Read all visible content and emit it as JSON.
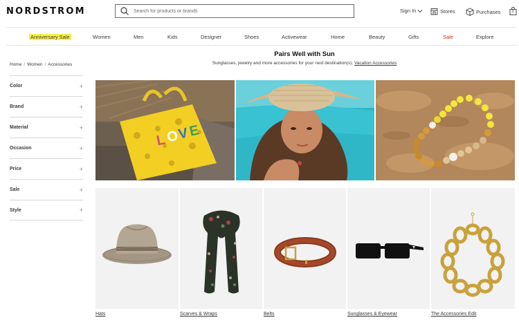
{
  "header": {
    "logo": "NORDSTROM",
    "search_placeholder": "Search for products or brands",
    "sign_in": "Sign In",
    "stores": "Stores",
    "purchases": "Purchases",
    "bag_count": "0"
  },
  "nav": [
    "Anniversary Sale",
    "Women",
    "Men",
    "Kids",
    "Designer",
    "Shoes",
    "Activewear",
    "Home",
    "Beauty",
    "Gifts",
    "Sale",
    "Explore"
  ],
  "breadcrumb": [
    "Home",
    "Women",
    "Accessories"
  ],
  "filters": [
    "Color",
    "Brand",
    "Material",
    "Occasion",
    "Price",
    "Sale",
    "Style"
  ],
  "main": {
    "title": "Pairs Well with Sun",
    "subtitle": "Sunglasses, jewelry and more accessories for your next destination(s).",
    "subtitle_link": "Vacation Accessories"
  },
  "categories": [
    "Hats",
    "Scarves & Wraps",
    "Belts",
    "Sunglasses & Eyewear",
    "The Accessories Edit"
  ],
  "colors": {
    "highlight": "#f7f04a",
    "sale": "#d9241c",
    "tile_bg": "#f2f2f2"
  }
}
